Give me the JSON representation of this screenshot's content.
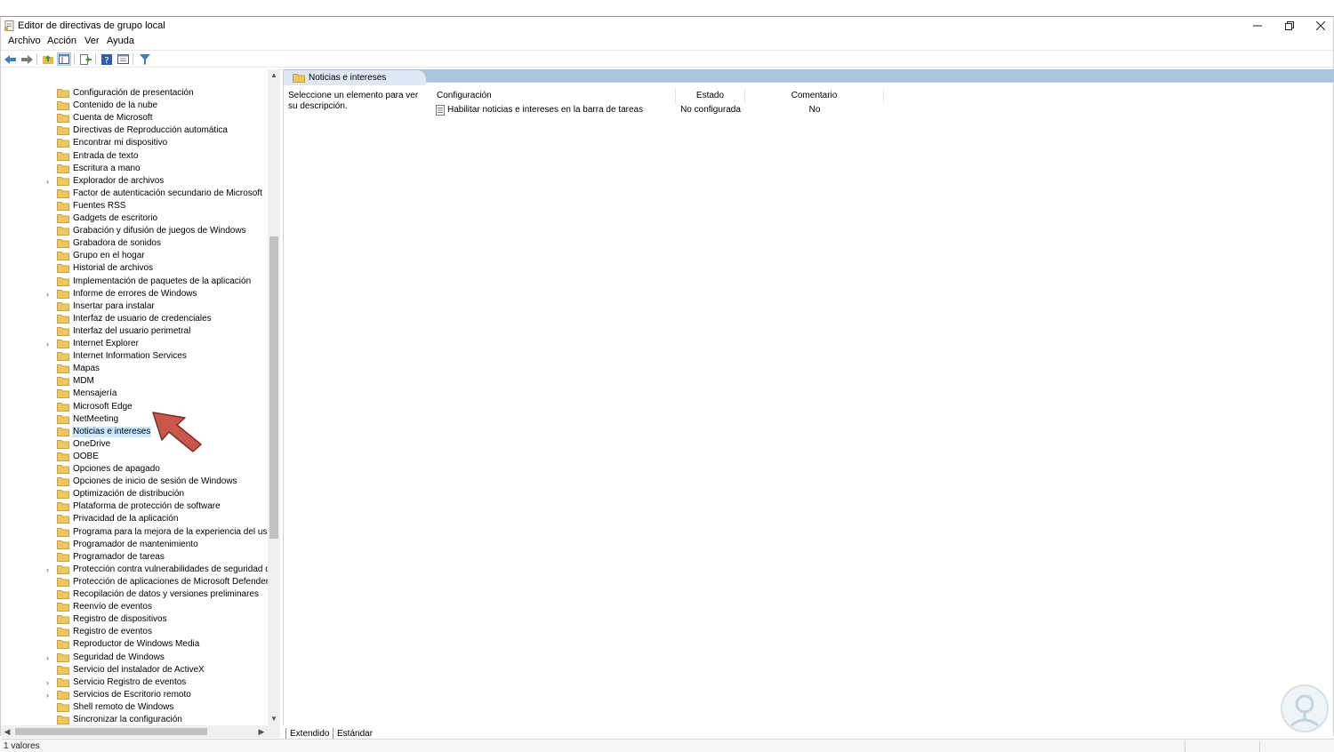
{
  "window": {
    "title": "Editor de directivas de grupo local"
  },
  "menu": [
    "Archivo",
    "Acción",
    "Ver",
    "Ayuda"
  ],
  "toolbar": {
    "icons": [
      "back-arrow-icon",
      "forward-arrow-icon",
      "up-folder-icon",
      "show-hide-tree-icon",
      "export-list-icon",
      "help-icon",
      "properties-icon",
      "filter-icon"
    ],
    "active": "show-hide-tree-icon"
  },
  "tree": {
    "items": [
      {
        "label": "Configuración de presentación",
        "expandable": false
      },
      {
        "label": "Contenido de la nube",
        "expandable": false
      },
      {
        "label": "Cuenta de Microsoft",
        "expandable": false
      },
      {
        "label": "Directivas de Reproducción automática",
        "expandable": false
      },
      {
        "label": "Encontrar mi dispositivo",
        "expandable": false
      },
      {
        "label": "Entrada de texto",
        "expandable": false
      },
      {
        "label": "Escritura a mano",
        "expandable": false
      },
      {
        "label": "Explorador de archivos",
        "expandable": true
      },
      {
        "label": "Factor de autenticación secundario de Microsoft",
        "expandable": false
      },
      {
        "label": "Fuentes RSS",
        "expandable": false
      },
      {
        "label": "Gadgets de escritorio",
        "expandable": false
      },
      {
        "label": "Grabación y difusión de juegos de Windows",
        "expandable": false
      },
      {
        "label": "Grabadora de sonidos",
        "expandable": false
      },
      {
        "label": "Grupo en el hogar",
        "expandable": false
      },
      {
        "label": "Historial de archivos",
        "expandable": false
      },
      {
        "label": "Implementación de paquetes de la aplicación",
        "expandable": false
      },
      {
        "label": "Informe de errores de Windows",
        "expandable": true
      },
      {
        "label": "Insertar para instalar",
        "expandable": false
      },
      {
        "label": "Interfaz de usuario de credenciales",
        "expandable": false
      },
      {
        "label": "Interfaz del usuario perimetral",
        "expandable": false
      },
      {
        "label": "Internet Explorer",
        "expandable": true
      },
      {
        "label": "Internet Information Services",
        "expandable": false
      },
      {
        "label": "Mapas",
        "expandable": false
      },
      {
        "label": "MDM",
        "expandable": false
      },
      {
        "label": "Mensajería",
        "expandable": false
      },
      {
        "label": "Microsoft Edge",
        "expandable": false
      },
      {
        "label": "NetMeeting",
        "expandable": false
      },
      {
        "label": "Noticias e intereses",
        "expandable": false,
        "selected": true
      },
      {
        "label": "OneDrive",
        "expandable": false
      },
      {
        "label": "OOBE",
        "expandable": false
      },
      {
        "label": "Opciones de apagado",
        "expandable": false
      },
      {
        "label": "Opciones de inicio de sesión de Windows",
        "expandable": false
      },
      {
        "label": "Optimización de distribución",
        "expandable": false
      },
      {
        "label": "Plataforma de protección de software",
        "expandable": false
      },
      {
        "label": "Privacidad de la aplicación",
        "expandable": false
      },
      {
        "label": "Programa para la mejora de la experiencia del usuario",
        "expandable": false
      },
      {
        "label": "Programador de mantenimiento",
        "expandable": false
      },
      {
        "label": "Programador de tareas",
        "expandable": false
      },
      {
        "label": "Protección contra vulnerabilidades de seguridad de M",
        "expandable": true
      },
      {
        "label": "Protección de aplicaciones de Microsoft Defender",
        "expandable": false
      },
      {
        "label": "Recopilación de datos y versiones preliminares",
        "expandable": false
      },
      {
        "label": "Reenvío de eventos",
        "expandable": false
      },
      {
        "label": "Registro de dispositivos",
        "expandable": false
      },
      {
        "label": "Registro de eventos",
        "expandable": false
      },
      {
        "label": "Reproductor de Windows Media",
        "expandable": false
      },
      {
        "label": "Seguridad de Windows",
        "expandable": true
      },
      {
        "label": "Servicio del instalador de ActiveX",
        "expandable": false
      },
      {
        "label": "Servicio Registro de eventos",
        "expandable": true
      },
      {
        "label": "Servicios de Escritorio remoto",
        "expandable": true
      },
      {
        "label": "Shell remoto de Windows",
        "expandable": false
      },
      {
        "label": "Sincronizar la configuración",
        "expandable": false
      }
    ]
  },
  "details": {
    "header_title": "Noticias e intereses",
    "description": "Seleccione un elemento para ver su descripción.",
    "columns": [
      "Configuración",
      "Estado",
      "Comentario"
    ],
    "rows": [
      {
        "setting": "Habilitar noticias e intereses en la barra de tareas",
        "state": "No configurada",
        "comment": "No"
      }
    ]
  },
  "tabs": [
    "Extendido",
    "Estándar"
  ],
  "status": "1 valores",
  "colors": {
    "selection": "#cce8ff",
    "header_band": "#a8c4e0",
    "folder": "#f0c75e",
    "arrow": "#c9574b"
  }
}
